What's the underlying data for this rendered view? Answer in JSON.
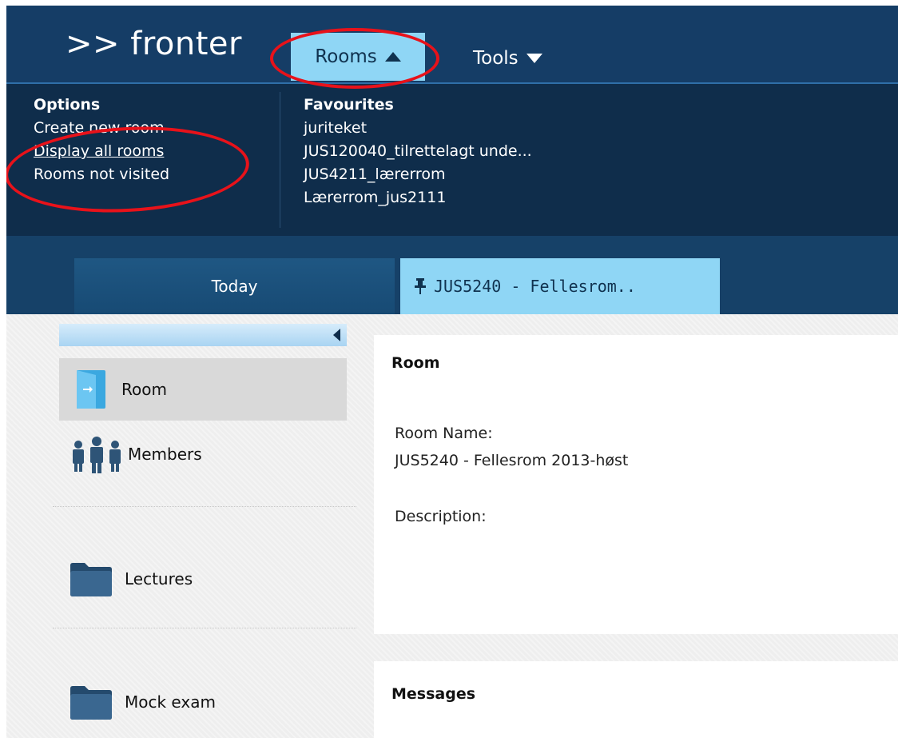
{
  "nav": {
    "logo": ">> fronter",
    "rooms_label": "Rooms",
    "tools_label": "Tools"
  },
  "dropdown": {
    "options_heading": "Options",
    "options": [
      "Create new room",
      "Display all rooms",
      "Rooms not visited"
    ],
    "favourites_heading": "Favourites",
    "favourites": [
      "juriteket",
      "JUS120040_tilrettelagt unde...",
      "JUS4211_lærerrom",
      "Lærerrom_jus2111"
    ]
  },
  "tabs": {
    "today": "Today",
    "room": "JUS5240 - Fellesrom.."
  },
  "sidebar": {
    "items": [
      {
        "label": "Room",
        "icon": "door-icon"
      },
      {
        "label": "Members",
        "icon": "people-icon"
      },
      {
        "label": "Lectures",
        "icon": "folder-icon"
      },
      {
        "label": "Mock exam",
        "icon": "folder-icon"
      }
    ]
  },
  "room_panel": {
    "title": "Room",
    "name_label": "Room Name:",
    "name_value": "JUS5240 - Fellesrom 2013-høst",
    "description_label": "Description:"
  },
  "messages_panel": {
    "title": "Messages"
  },
  "colors": {
    "nav_bg": "#153d66",
    "dropdown_bg": "#0f2d4b",
    "accent_tab": "#8fd6f5",
    "annotation": "#e8121a"
  }
}
